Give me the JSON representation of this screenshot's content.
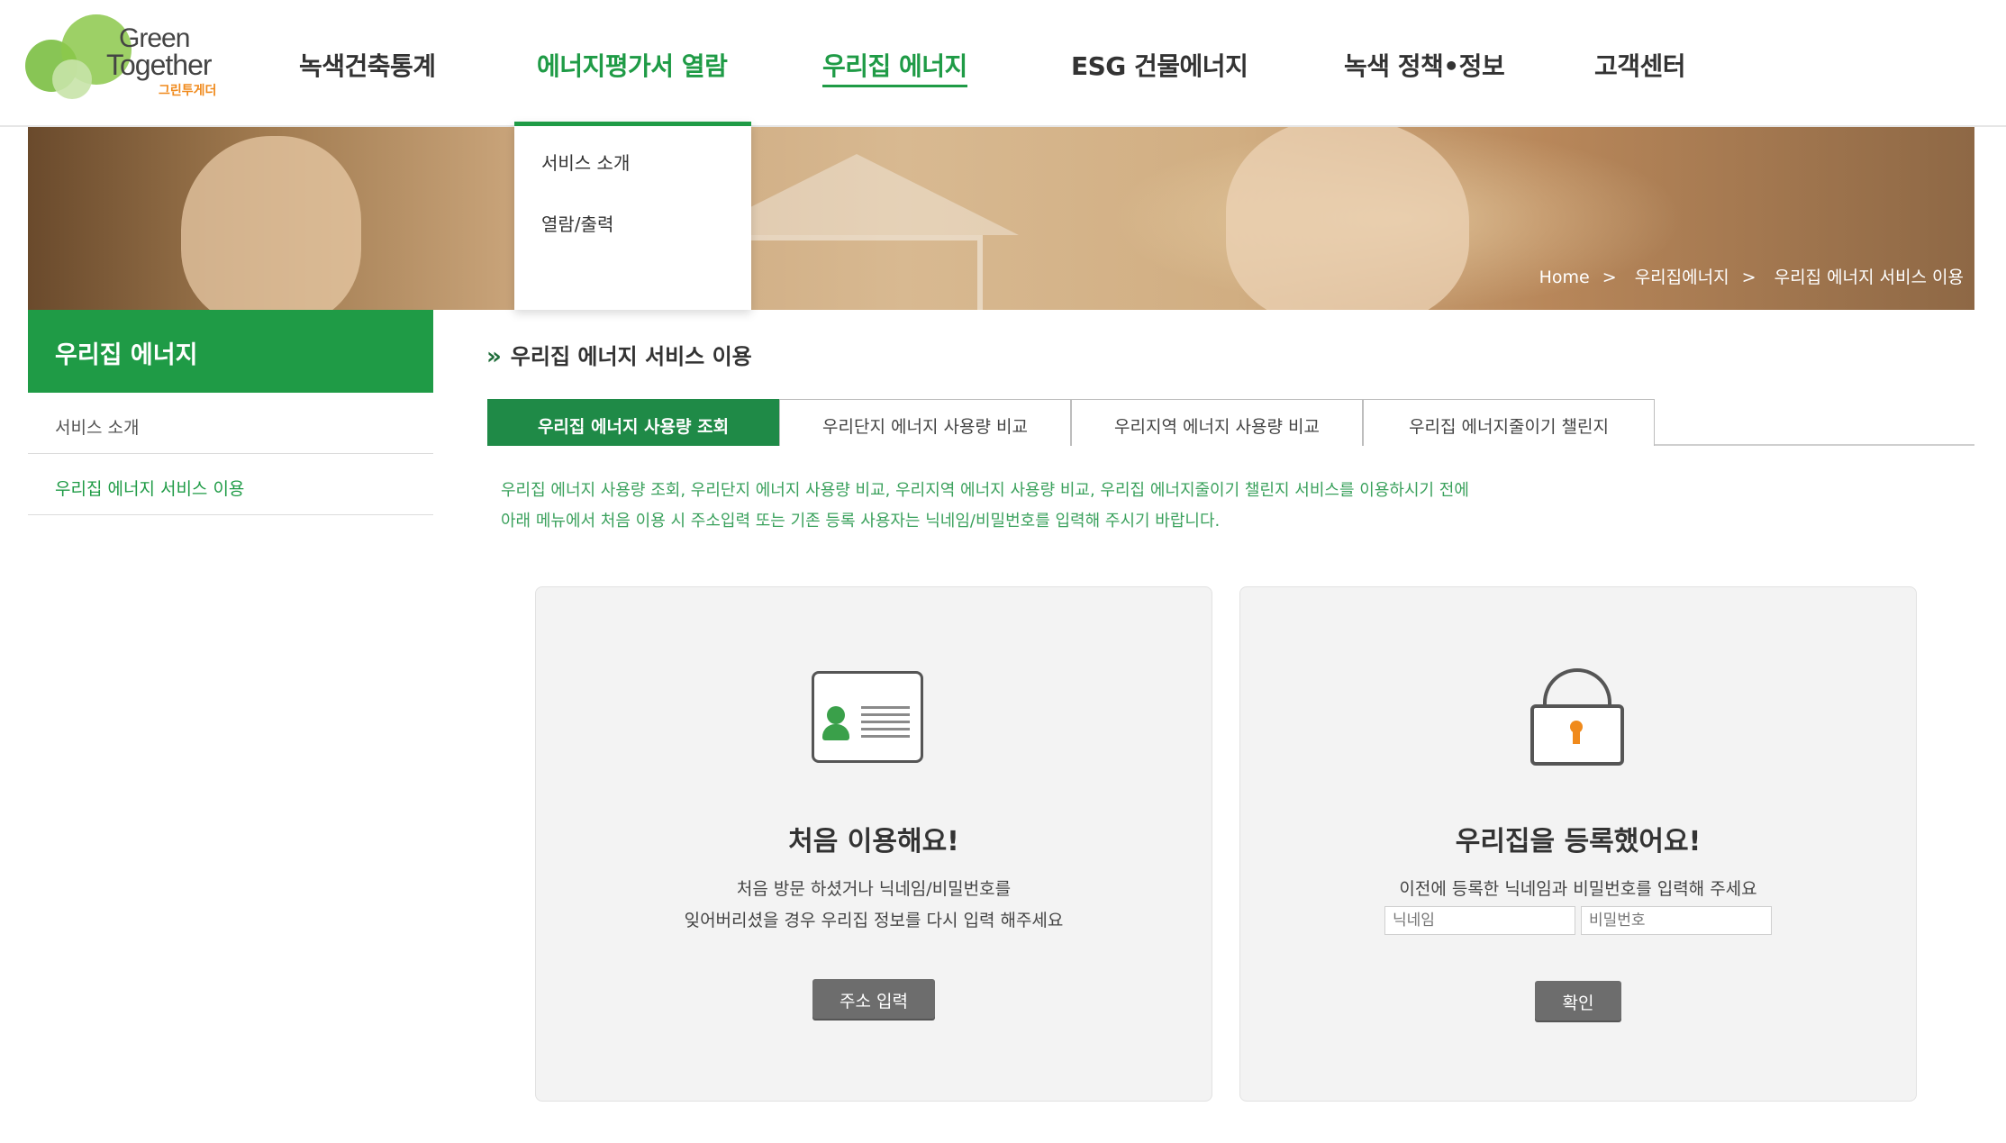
{
  "logo": {
    "line1": "Green",
    "line2": "Together",
    "sub": "그린투게더"
  },
  "gnb": {
    "items": [
      {
        "label": "녹색건축통계"
      },
      {
        "label": "에너지평가서 열람"
      },
      {
        "label": "우리집 에너지"
      },
      {
        "label": "ESG 건물에너지"
      },
      {
        "label": "녹색 정책•정보"
      },
      {
        "label": "고객센터"
      }
    ]
  },
  "dropdown": {
    "items": [
      {
        "label": "서비스 소개"
      },
      {
        "label": "열람/출력"
      }
    ]
  },
  "breadcrumb": {
    "home": "Home",
    "sep": ">",
    "level1": "우리집에너지",
    "level2": "우리집 에너지 서비스 이용"
  },
  "lnb": {
    "title": "우리집 에너지",
    "items": [
      {
        "label": "서비스 소개"
      },
      {
        "label": "우리집 에너지 서비스 이용"
      }
    ]
  },
  "page_title": "우리집 에너지 서비스 이용",
  "tabs": [
    {
      "label": "우리집 에너지 사용량 조회"
    },
    {
      "label": "우리단지 에너지 사용량 비교"
    },
    {
      "label": "우리지역 에너지 사용량 비교"
    },
    {
      "label": "우리집 에너지줄이기 챌린지"
    }
  ],
  "notice": {
    "line1": "우리집 에너지 사용량 조회, 우리단지 에너지 사용량 비교, 우리지역 에너지 사용량 비교, 우리집 에너지줄이기 챌린지 서비스를 이용하시기 전에",
    "line2": "아래 메뉴에서 처음 이용 시 주소입력 또는 기존 등록 사용자는 닉네임/비밀번호를 입력해 주시기 바랍니다."
  },
  "card_new": {
    "title": "처음 이용해요!",
    "desc1": "처음 방문 하셨거나 닉네임/비밀번호를",
    "desc2": "잊어버리셨을 경우 우리집 정보를 다시 입력 해주세요",
    "button": "주소 입력",
    "icon": "id-card-icon"
  },
  "card_registered": {
    "title": "우리집을 등록했어요!",
    "desc": "이전에 등록한 닉네임과 비밀번호를 입력해 주세요",
    "nickname_placeholder": "닉네임",
    "password_placeholder": "비밀번호",
    "button": "확인",
    "icon": "lock-icon"
  },
  "colors": {
    "brand_green": "#1f9b46",
    "button_gray": "#6d6d6d",
    "key_orange": "#f08a1c"
  }
}
